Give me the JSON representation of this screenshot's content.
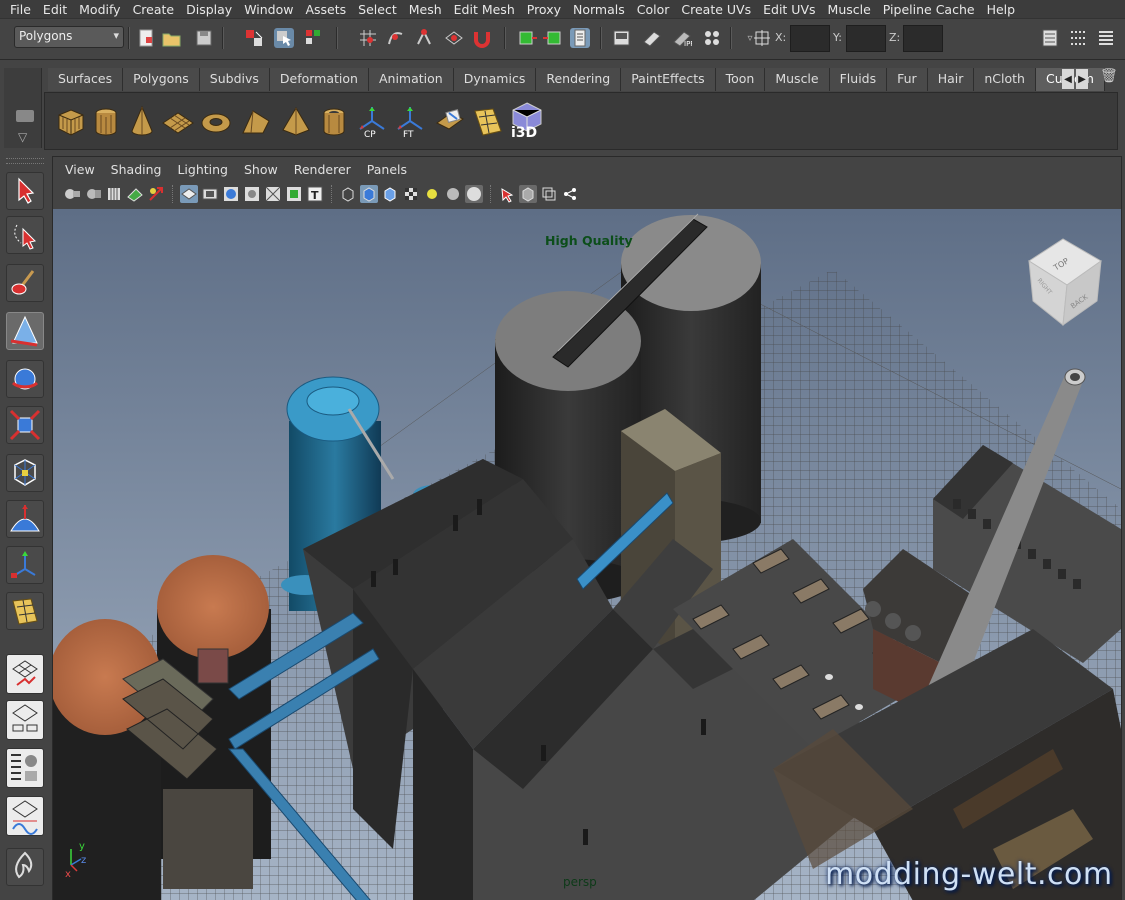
{
  "menubar": {
    "items": [
      "File",
      "Edit",
      "Modify",
      "Create",
      "Display",
      "Window",
      "Assets",
      "Select",
      "Mesh",
      "Edit Mesh",
      "Proxy",
      "Normals",
      "Color",
      "Create UVs",
      "Edit UVs",
      "Muscle",
      "Pipeline Cache",
      "Help"
    ]
  },
  "statusline": {
    "mode": "Polygons",
    "x_label": "X:",
    "y_label": "Y:",
    "z_label": "Z:"
  },
  "shelf": {
    "tabs": [
      "Surfaces",
      "Polygons",
      "Subdivs",
      "Deformation",
      "Animation",
      "Dynamics",
      "Rendering",
      "PaintEffects",
      "Toon",
      "Muscle",
      "Fluids",
      "Fur",
      "Hair",
      "nCloth",
      "Custom"
    ],
    "active_tab": "Custom",
    "tools": [
      "poly-cube-icon",
      "poly-cylinder-icon",
      "poly-cone-icon",
      "poly-plane-icon",
      "poly-torus-icon",
      "poly-prism-icon",
      "poly-pyramid-icon",
      "poly-pipe-icon",
      "center-pivot-icon",
      "freeze-transforms-icon",
      "uv-planar-icon",
      "uv-editor-icon",
      "i3d-exporter-icon"
    ],
    "tool_labels": {
      "cp": "CP",
      "ft": "FT",
      "i3d": "i3D"
    }
  },
  "panel": {
    "menu": [
      "View",
      "Shading",
      "Lighting",
      "Show",
      "Renderer",
      "Panels"
    ]
  },
  "viewport": {
    "quality_label": "High Quality",
    "camera_label": "persp",
    "view_cube_labels": {
      "top": "TOP",
      "back": "BACK",
      "right": "RIGHT"
    },
    "axis_labels": {
      "x": "x",
      "y": "y",
      "z": "z"
    }
  },
  "watermark": "modding-welt.com"
}
